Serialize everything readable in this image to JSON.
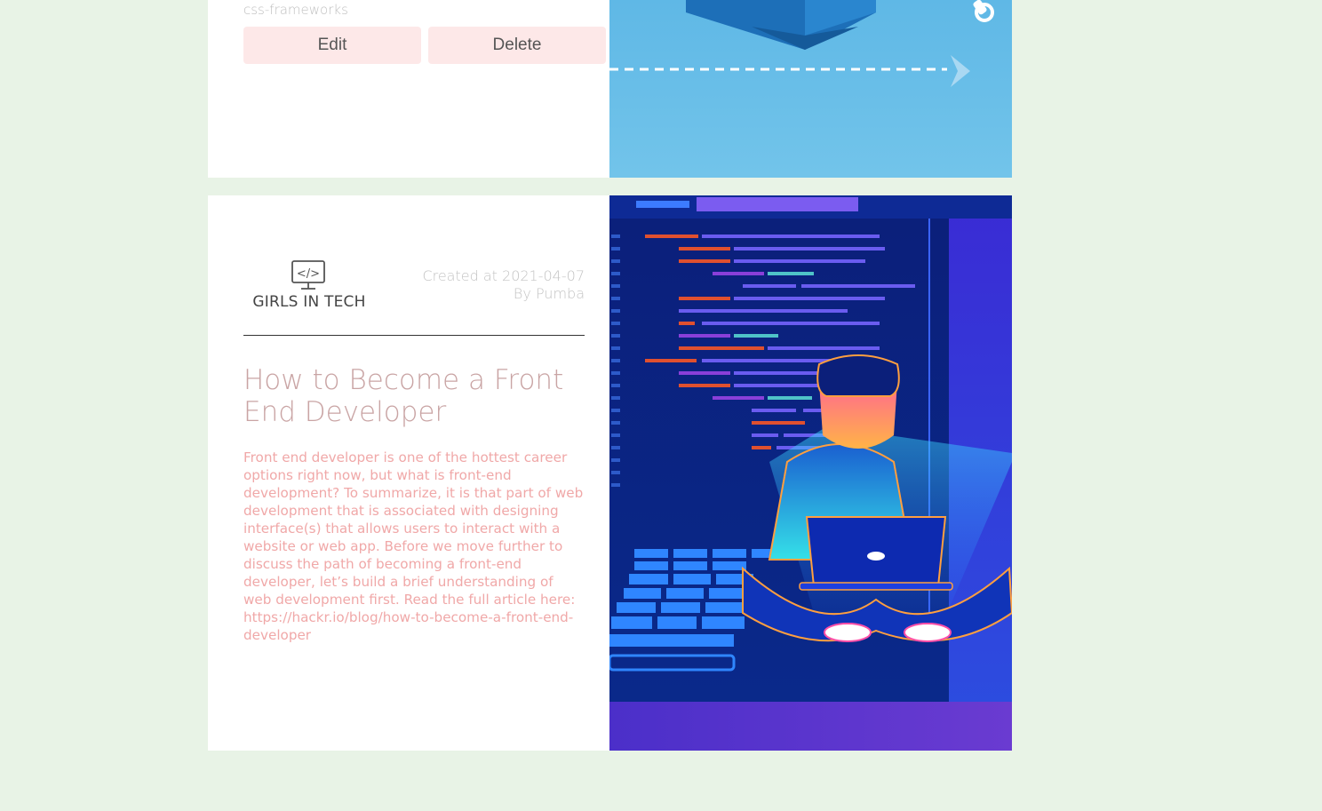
{
  "posts": [
    {
      "snippet_tail": "css-frameworks",
      "edit_label": "Edit",
      "delete_label": "Delete"
    },
    {
      "logo_text": "GIRLS IN TECH",
      "logo_glyph": "</>",
      "created": "Created at 2021-04-07",
      "author": "By Pumba",
      "title": "How to Become a Front End Developer",
      "body": "Front end developer is one of the hottest career options right now, but what is front-end development? To summarize, it is that part of web development that is associated with designing interface(s) that allows users to interact with a website or web app. Before we move further to discuss the path of becoming a front-end developer, let’s build a brief understanding of web development first. Read the full article here: https://hackr.io/blog/how-to-become-a-front-end-developer"
    }
  ],
  "colors": {
    "page_bg": "#e8f3e6",
    "card_bg": "#ffffff",
    "button_bg": "#fde8e8",
    "title": "#c9a4a4",
    "body_text": "#f0a8a8",
    "meta_text": "#c4c4c4"
  }
}
